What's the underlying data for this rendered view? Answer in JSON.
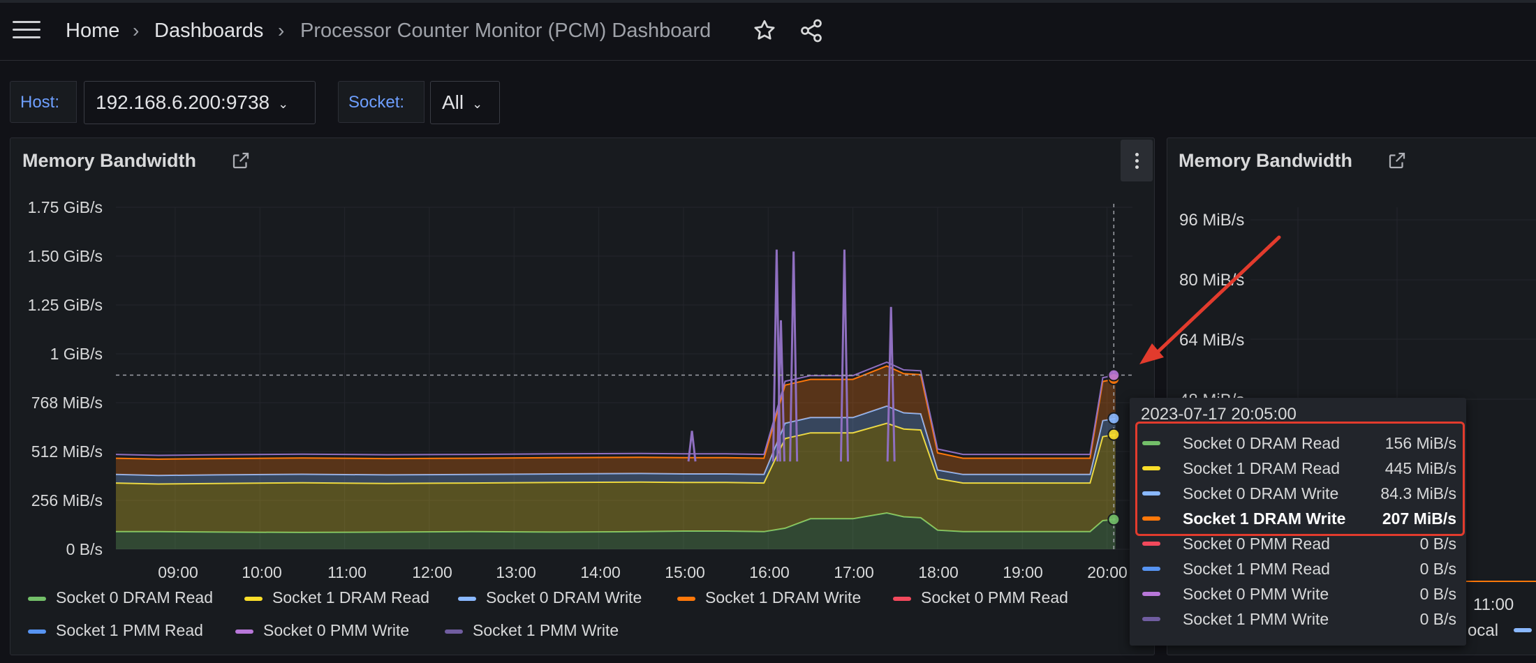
{
  "header": {
    "breadcrumbs": [
      "Home",
      "Dashboards",
      "Processor Counter Monitor (PCM) Dashboard"
    ]
  },
  "variables": {
    "host": {
      "label": "Host:",
      "value": "192.168.6.200:9738"
    },
    "socket": {
      "label": "Socket:",
      "value": "All"
    }
  },
  "panels": {
    "left": {
      "title": "Memory Bandwidth"
    },
    "right": {
      "title": "Memory Bandwidth",
      "y_ticks": [
        "96 MiB/s",
        "80 MiB/s",
        "64 MiB/s",
        "48 MiB/s"
      ],
      "x_tick": "11:00",
      "legend_fragment": "ocal"
    }
  },
  "tooltip": {
    "time": "2023-07-17 20:05:00",
    "rows": [
      {
        "name": "Socket 0 DRAM Read",
        "value": "156 MiB/s",
        "color": "#73bf69"
      },
      {
        "name": "Socket 1 DRAM Read",
        "value": "445 MiB/s",
        "color": "#fade2a"
      },
      {
        "name": "Socket 0 DRAM Write",
        "value": "84.3 MiB/s",
        "color": "#8ab8ff"
      },
      {
        "name": "Socket 1 DRAM Write",
        "value": "207 MiB/s",
        "color": "#ff780a"
      },
      {
        "name": "Socket 0 PMM Read",
        "value": "0 B/s",
        "color": "#f2495c"
      },
      {
        "name": "Socket 1 PMM Read",
        "value": "0 B/s",
        "color": "#5794f2"
      },
      {
        "name": "Socket 0 PMM Write",
        "value": "0 B/s",
        "color": "#b877d9"
      },
      {
        "name": "Socket 1 PMM Write",
        "value": "0 B/s",
        "color": "#705da0"
      }
    ]
  },
  "chart_data": {
    "type": "area",
    "title": "Memory Bandwidth",
    "y_ticks": [
      "0 B/s",
      "256 MiB/s",
      "512 MiB/s",
      "768 MiB/s",
      "1 GiB/s",
      "1.25 GiB/s",
      "1.50 GiB/s",
      "1.75 GiB/s"
    ],
    "ylim_mib": [
      0,
      1792
    ],
    "x_ticks": [
      "09:00",
      "10:00",
      "11:00",
      "12:00",
      "13:00",
      "14:00",
      "15:00",
      "16:00",
      "17:00",
      "18:00",
      "19:00",
      "20:00"
    ],
    "x_hours": [
      8.3,
      8.8,
      9.5,
      10.5,
      11.5,
      12.5,
      13.5,
      14.5,
      15.0,
      15.5,
      15.95,
      16.2,
      16.5,
      17.0,
      17.4,
      17.6,
      17.8,
      18.0,
      18.3,
      19.0,
      19.8,
      19.95,
      20.1
    ],
    "stacked": true,
    "series": [
      {
        "name": "Socket 0 DRAM Read",
        "color": "#73bf69",
        "values": [
          92,
          92,
          90,
          88,
          90,
          92,
          90,
          92,
          95,
          95,
          92,
          110,
          160,
          160,
          190,
          170,
          165,
          100,
          92,
          92,
          92,
          150,
          156
        ]
      },
      {
        "name": "Socket 1 DRAM Read",
        "color": "#fade2a",
        "values": [
          255,
          250,
          255,
          260,
          255,
          255,
          260,
          260,
          255,
          255,
          255,
          470,
          450,
          450,
          470,
          460,
          460,
          270,
          255,
          255,
          255,
          440,
          445
        ]
      },
      {
        "name": "Socket 0 DRAM Write",
        "color": "#8ab8ff",
        "values": [
          45,
          45,
          45,
          45,
          45,
          45,
          45,
          45,
          45,
          45,
          45,
          80,
          80,
          80,
          90,
          85,
          85,
          45,
          45,
          45,
          45,
          84,
          84.3
        ]
      },
      {
        "name": "Socket 1 DRAM Write",
        "color": "#ff780a",
        "values": [
          85,
          85,
          85,
          85,
          85,
          85,
          85,
          85,
          85,
          85,
          85,
          200,
          200,
          200,
          210,
          205,
          205,
          90,
          85,
          85,
          85,
          205,
          207
        ]
      },
      {
        "name": "Socket 0 PMM Read",
        "color": "#f2495c",
        "values": [
          0,
          0,
          0,
          0,
          0,
          0,
          0,
          0,
          0,
          0,
          0,
          0,
          0,
          0,
          0,
          0,
          0,
          0,
          0,
          0,
          0,
          0,
          0
        ]
      },
      {
        "name": "Socket 1 PMM Read",
        "color": "#5794f2",
        "values": [
          0,
          0,
          0,
          0,
          0,
          0,
          0,
          0,
          0,
          0,
          0,
          0,
          0,
          0,
          0,
          0,
          0,
          0,
          0,
          0,
          0,
          0,
          0
        ]
      },
      {
        "name": "Socket 0 PMM Write",
        "color": "#b877d9",
        "values": [
          0,
          0,
          0,
          0,
          0,
          0,
          0,
          0,
          0,
          0,
          0,
          0,
          0,
          0,
          0,
          0,
          0,
          0,
          0,
          0,
          0,
          0,
          0
        ]
      },
      {
        "name": "Socket 1 PMM Write",
        "color": "#705da0",
        "values": [
          0,
          0,
          0,
          0,
          0,
          0,
          0,
          0,
          0,
          0,
          0,
          0,
          0,
          0,
          0,
          0,
          0,
          0,
          0,
          0,
          0,
          0,
          0
        ]
      }
    ],
    "spikes": [
      {
        "x": 15.1,
        "value": 620
      },
      {
        "x": 16.1,
        "value": 1570
      },
      {
        "x": 16.15,
        "value": 1200
      },
      {
        "x": 16.3,
        "value": 1560
      },
      {
        "x": 16.9,
        "value": 1570
      },
      {
        "x": 17.45,
        "value": 1270
      }
    ],
    "legend": [
      "Socket 0 DRAM Read",
      "Socket 1 DRAM Read",
      "Socket 0 DRAM Write",
      "Socket 1 DRAM Write",
      "Socket 0 PMM Read",
      "Socket 1 PMM Read",
      "Socket 0 PMM Write",
      "Socket 1 PMM Write"
    ],
    "legend_placement": "bottom",
    "grid": true,
    "crosshair_x": "20:05"
  },
  "colors": {
    "background": "#111217",
    "panel": "#181b1f",
    "annotation": "#e23b2d",
    "variable_label": "#6e9fff"
  }
}
